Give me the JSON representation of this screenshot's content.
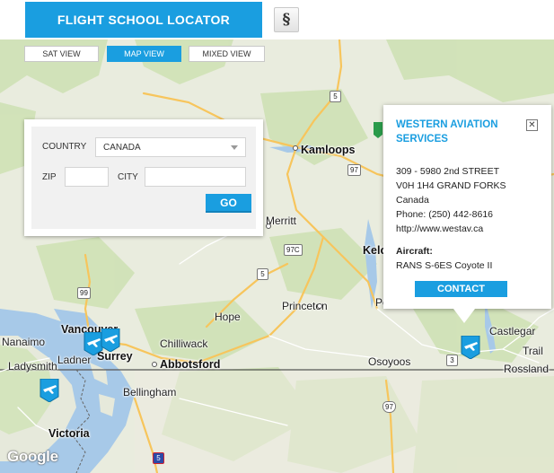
{
  "header": {
    "title": "FLIGHT SCHOOL LOCATOR",
    "section_symbol": "§"
  },
  "view_toggle": {
    "sat": "SAT VIEW",
    "map": "MAP VIEW",
    "mixed": "MIXED VIEW",
    "active": "map"
  },
  "search": {
    "country_label": "COUNTRY",
    "country_value": "CANADA",
    "zip_label": "ZIP",
    "zip_value": "",
    "city_label": "CITY",
    "city_value": "",
    "go_label": "GO"
  },
  "info_window": {
    "name": "WESTERN AVIATION SERVICES",
    "address_line1": "309 - 5980 2nd STREET",
    "address_line2": "V0H 1H4 GRAND FORKS",
    "country": "Canada",
    "phone": "Phone: (250) 442-8616",
    "website": "http://www.westav.ca",
    "aircraft_label": "Aircraft:",
    "aircraft_value": "RANS S-6ES Coyote II",
    "contact_label": "CONTACT",
    "close_glyph": "✕"
  },
  "map": {
    "places": {
      "kamloops": "Kamloops",
      "merritt": "Merritt",
      "kelowna": "Kelo",
      "penticton": "Penticton",
      "princeton": "Princeton",
      "hope": "Hope",
      "vancouver": "Vancouver",
      "nanaimo": "Nanaimo",
      "ladysmith": "Ladysmith",
      "ladner": "Ladner",
      "surrey": "Surrey",
      "chilliwack": "Chilliwack",
      "abbotsford": "Abbotsford",
      "bellingham": "Bellingham",
      "victoria": "Victoria",
      "osoyoos": "Osoyoos",
      "castlegar": "Castlegar",
      "trail": "Trail",
      "rossland": "Rossland"
    },
    "highways": {
      "h5a": "5",
      "h97a": "97",
      "h97c": "97C",
      "h5b": "5",
      "h99": "99",
      "h3": "3",
      "h97us": "97",
      "i5": "5"
    },
    "google_label": "Google",
    "marker_icon": "airplane-icon",
    "colors": {
      "accent": "#1a9ee0",
      "water": "#a7c9e8",
      "land": "#e9ecde",
      "forest": "#c9dfae",
      "road_major": "#f7c55c"
    }
  }
}
